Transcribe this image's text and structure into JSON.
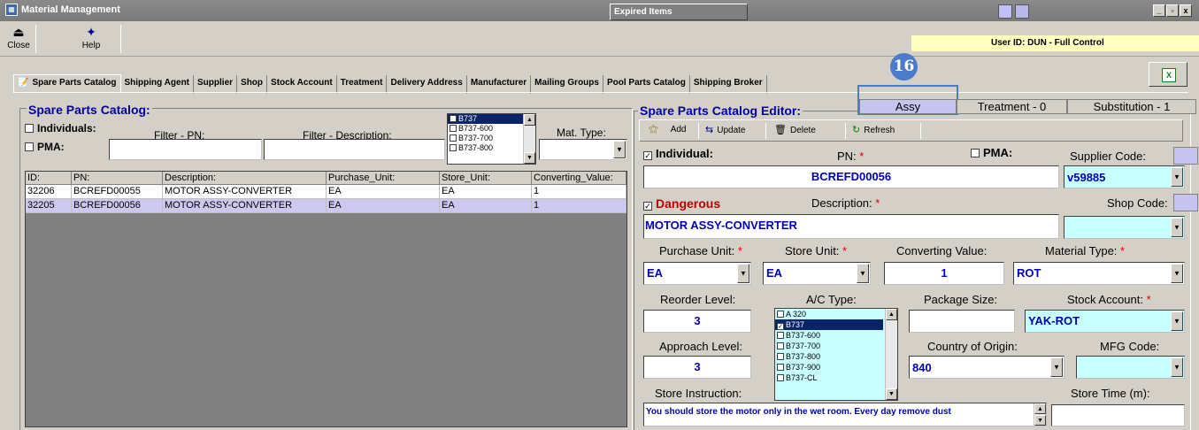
{
  "window": {
    "title": "Material Management",
    "expired_tab": "Expired Items",
    "minimize": "_",
    "maximize": "▫",
    "close": "x"
  },
  "toolbar": {
    "close_label": "Close",
    "help_label": "Help",
    "user_id": "User ID: DUN - Full Control"
  },
  "tabs": [
    {
      "label": "Spare Parts Catalog"
    },
    {
      "label": "Shipping Agent"
    },
    {
      "label": "Supplier"
    },
    {
      "label": "Shop"
    },
    {
      "label": "Stock Account"
    },
    {
      "label": "Treatment"
    },
    {
      "label": "Delivery Address"
    },
    {
      "label": "Manufacturer"
    },
    {
      "label": "Mailing Groups"
    },
    {
      "label": "Pool Parts Catalog"
    },
    {
      "label": "Shipping Broker"
    }
  ],
  "callout": {
    "number": "16"
  },
  "catalog": {
    "title": "Spare Parts Catalog:",
    "individuals_label": "Individuals:",
    "pma_label": "PMA:",
    "filter_pn_label": "Filter - PN:",
    "filter_desc_label": "Filter - Description:",
    "mat_type_label": "Mat. Type:",
    "ac_list": [
      "B737",
      "B737-600",
      "B737-700",
      "B737-800"
    ],
    "columns": [
      "ID:",
      "PN:",
      "Description:",
      "Purchase_Unit:",
      "Store_Unit:",
      "Converting_Value:"
    ],
    "rows": [
      [
        "32206",
        "BCREFD00055",
        "MOTOR ASSY-CONVERTER",
        "EA",
        "EA",
        "1"
      ],
      [
        "32205",
        "BCREFD00056",
        "MOTOR ASSY-CONVERTER",
        "EA",
        "EA",
        "1"
      ]
    ]
  },
  "editor": {
    "title": "Spare Parts Catalog Editor:",
    "tabs": [
      "Assy",
      "Treatment - 0",
      "Substitution - 1"
    ],
    "add_label": "Add",
    "update_label": "Update",
    "delete_label": "Delete",
    "refresh_label": "Refresh",
    "individual_label": "Individual:",
    "pn_label": "PN:",
    "pma_label": "PMA:",
    "supplier_code_label": "Supplier Code:",
    "pn_value": "BCREFD00056",
    "supplier_code_value": "v59885",
    "dangerous_label": "Dangerous",
    "description_label": "Description:",
    "shop_code_label": "Shop Code:",
    "description_value": "MOTOR ASSY-CONVERTER",
    "purchase_unit_label": "Purchase Unit:",
    "store_unit_label": "Store Unit:",
    "converting_value_label": "Converting Value:",
    "material_type_label": "Material Type:",
    "purchase_unit_value": "EA",
    "store_unit_value": "EA",
    "converting_value": "1",
    "material_type_value": "ROT",
    "reorder_level_label": "Reorder Level:",
    "ac_type_label": "A/C Type:",
    "package_size_label": "Package Size:",
    "stock_account_label": "Stock Account:",
    "reorder_level_value": "3",
    "stock_account_value": "YAK-ROT",
    "ac_types": [
      "A 320",
      "B737",
      "B737-600",
      "B737-700",
      "B737-800",
      "B737-900",
      "B737-CL"
    ],
    "approach_level_label": "Approach Level:",
    "approach_level_value": "3",
    "country_label": "Country of Origin:",
    "country_value": "840",
    "mfg_code_label": "MFG Code:",
    "store_instruction_label": "Store Instruction:",
    "store_time_label": "Store Time (m):",
    "store_instruction_value": "You should store the motor only in the wet room. Every day remove dust"
  }
}
